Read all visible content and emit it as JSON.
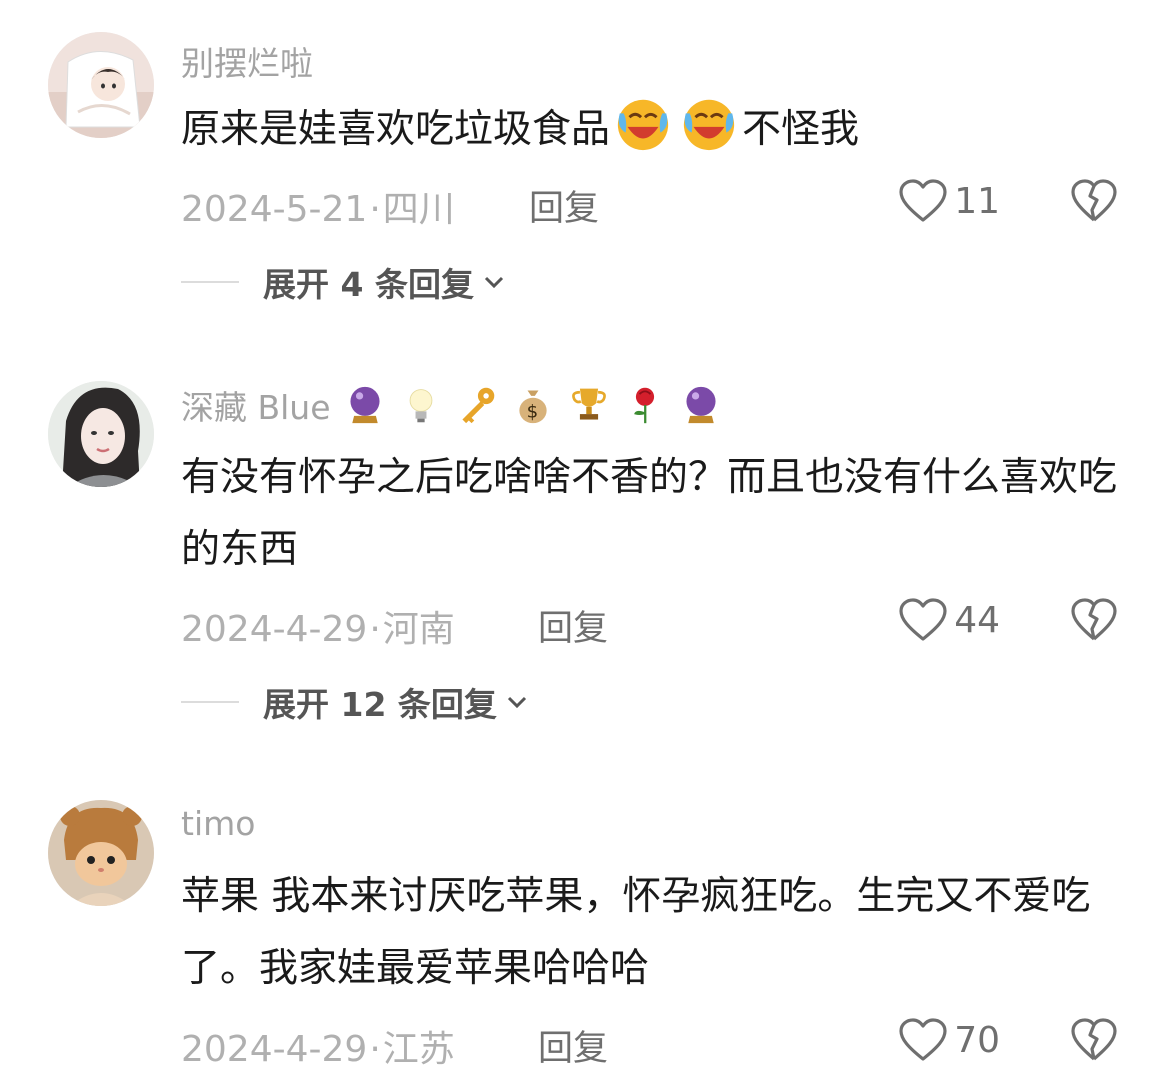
{
  "comments": [
    {
      "username": "别摆烂啦",
      "text_before": "原来是娃喜欢吃垃圾食品",
      "inline_emojis": [
        "laughing-crying-emoji",
        "laughing-crying-emoji"
      ],
      "text_after": "不怪我",
      "date": "2024-5-21",
      "location": "四川",
      "reply_label": "回复",
      "likes": "11",
      "expand_label": "展开 4 条回复"
    },
    {
      "username": "深藏 Blue",
      "badge_emojis": [
        "crystal-ball",
        "light-bulb",
        "key",
        "money-bag",
        "trophy",
        "rose",
        "crystal-ball"
      ],
      "text": "有没有怀孕之后吃啥啥不香的？而且也没有什么喜欢吃的东西",
      "date": "2024-4-29",
      "location": "河南",
      "reply_label": "回复",
      "likes": "44",
      "expand_label": "展开 12 条回复"
    },
    {
      "username": "timo",
      "text": "苹果 我本来讨厌吃苹果，怀孕疯狂吃。生完又不爱吃了。我家娃最爱苹果哈哈哈",
      "date": "2024-4-29",
      "location": "江苏",
      "reply_label": "回复",
      "likes": "70"
    }
  ],
  "date_separator": "·",
  "colors": {
    "text": "#1a1a1a",
    "meta": "#b0b0b0",
    "icon": "#6f6f6f"
  }
}
